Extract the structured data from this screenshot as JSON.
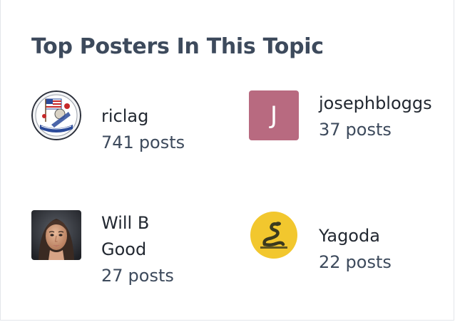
{
  "widget": {
    "title": "Top Posters In This Topic"
  },
  "posters": [
    {
      "username": "riclag",
      "post_count": "741",
      "post_unit": "posts",
      "avatar": "patriot-badge-avatar"
    },
    {
      "username": "josephbloggs",
      "post_count": "37",
      "post_unit": "posts",
      "avatar": "letter-avatar",
      "avatar_letter": "J",
      "avatar_color": "#b86a80"
    },
    {
      "username": "Will B Good",
      "post_count": "27",
      "post_unit": "posts",
      "avatar": "portrait-photo-avatar"
    },
    {
      "username": "Yagoda",
      "post_count": "22",
      "post_unit": "posts",
      "avatar": "gadsden-flag-avatar"
    }
  ],
  "colors": {
    "title": "#3d4a5c",
    "username": "#222831",
    "post_count": "#3d4a5c",
    "letter_avatar_bg": "#b86a80",
    "gadsden_yellow": "#f2c72e",
    "border": "#e3e6ea"
  }
}
